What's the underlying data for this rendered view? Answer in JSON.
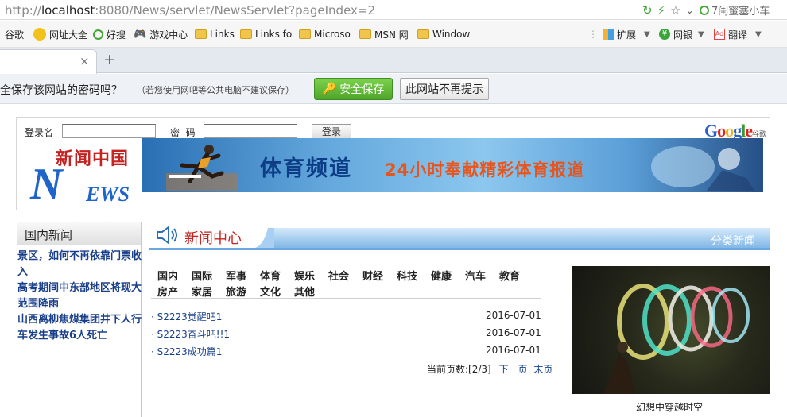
{
  "browser": {
    "url_prefix": "http://",
    "url_host": "localhost",
    "url_rest": ":8080/News/servlet/NewsServlet?pageIndex=2",
    "search_text": "7闺蜜塞小车"
  },
  "bookmarks": [
    {
      "label": "谷歌"
    },
    {
      "label": "网址大全"
    },
    {
      "label": "好搜"
    },
    {
      "label": "游戏中心"
    },
    {
      "label": "Links"
    },
    {
      "label": "Links fo"
    },
    {
      "label": "Microso"
    },
    {
      "label": "MSN 网"
    },
    {
      "label": "Window"
    }
  ],
  "bookmark_tools": {
    "extend": "扩展",
    "bank": "网银",
    "translate": "翻译"
  },
  "tab": {
    "close": "×",
    "new": "+"
  },
  "password_bar": {
    "message": "全保存该网站的密码吗？",
    "hint": "（若您使用网吧等公共电脑不建议保存）",
    "save_label": "安全保存",
    "never_label": "此网站不再提示"
  },
  "login": {
    "username_label": "登录名",
    "password_label": "密  码",
    "button_label": "登录"
  },
  "google": {
    "logo": "Google",
    "suffix": "谷歌"
  },
  "logo": {
    "cn": "新闻中国",
    "n": "N",
    "ews": "EWS"
  },
  "banner": {
    "title": "体育频道",
    "slogan": "24小时奉献精彩体育报道"
  },
  "left_panel": {
    "title": "国内新闻",
    "items": [
      "景区，如何不再依靠门票收入",
      "高考期间中东部地区将现大范围降雨",
      "山西离柳焦煤集团井下人行车发生事故6人死亡"
    ]
  },
  "news_center": {
    "title": "新闻中心",
    "right_label": "分类新闻"
  },
  "categories": [
    "国内",
    "国际",
    "军事",
    "体育",
    "娱乐",
    "社会",
    "财经",
    "科技",
    "健康",
    "汽车",
    "教育",
    "房产",
    "家居",
    "旅游",
    "文化",
    "其他"
  ],
  "news_list": [
    {
      "title": "· S2223觉醒吧1",
      "date": "2016-07-01"
    },
    {
      "title": "· S2223奋斗吧!!1",
      "date": "2016-07-01"
    },
    {
      "title": "· S2223成功篇1",
      "date": "2016-07-01"
    }
  ],
  "pager": {
    "label": "当前页数:[2/3]",
    "next": "下一页",
    "last": "末页"
  },
  "photo": {
    "caption": "幻想中穿越时空"
  },
  "colors": {
    "accent_red": "#c52222",
    "link_blue": "#1a3f8a",
    "save_green": "#4ea52b"
  }
}
